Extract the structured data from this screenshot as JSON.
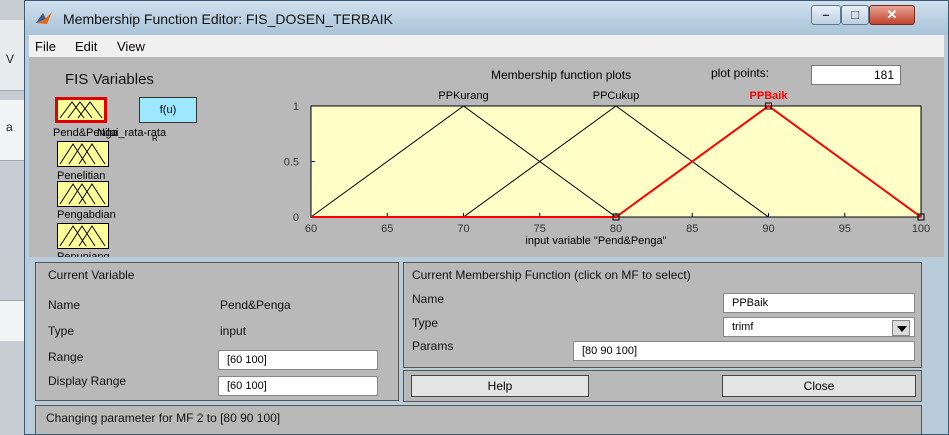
{
  "window": {
    "title": "Membership Function Editor: FIS_DOSEN_TERBAIK"
  },
  "menu": [
    "File",
    "Edit",
    "View"
  ],
  "background_letters": [
    "V",
    "a"
  ],
  "fis_variables": {
    "heading": "FIS Variables",
    "inputs": [
      {
        "label": "Pend&Penga",
        "selected": true
      },
      {
        "label": "Penelitian",
        "selected": false
      },
      {
        "label": "Pengabdian",
        "selected": false
      },
      {
        "label": "Penunjang",
        "selected": false
      }
    ],
    "output_label": "f(u)",
    "output_name": "Nilai_rata-rata",
    "output_glyph": "R"
  },
  "plot": {
    "title": "Membership function plots",
    "plot_points_label": "plot points:",
    "plot_points_value": "181"
  },
  "chart_data": {
    "type": "line",
    "xlabel": "input variable \"Pend&Penga\"",
    "xlim": [
      60,
      100
    ],
    "ylim": [
      0,
      1
    ],
    "xticks": [
      60,
      65,
      70,
      75,
      80,
      85,
      90,
      95,
      100
    ],
    "yticks": [
      0,
      0.5,
      1
    ],
    "series": [
      {
        "name": "PPKurang",
        "params": [
          60,
          70,
          80
        ],
        "color": "#000000",
        "selected": false
      },
      {
        "name": "PPCukup",
        "params": [
          70,
          80,
          90
        ],
        "color": "#000000",
        "selected": false
      },
      {
        "name": "PPBaik",
        "params": [
          80,
          90,
          100
        ],
        "color": "#ff0000",
        "selected": true
      }
    ]
  },
  "current_variable": {
    "heading": "Current Variable",
    "name_label": "Name",
    "name_value": "Pend&Penga",
    "type_label": "Type",
    "type_value": "input",
    "range_label": "Range",
    "range_value": "[60 100]",
    "display_range_label": "Display Range",
    "display_range_value": "[60 100]"
  },
  "current_mf": {
    "heading": "Current Membership Function (click on MF to select)",
    "name_label": "Name",
    "name_value": "PPBaik",
    "type_label": "Type",
    "type_value": "trimf",
    "params_label": "Params",
    "params_value": "[80 90 100]"
  },
  "buttons": {
    "help": "Help",
    "close": "Close"
  },
  "status": "Changing parameter for MF 2 to  [80 90 100]",
  "colors": {
    "mf_bg": "#ffff9a",
    "output_box": "#9ee8ff",
    "selected": "#ff0000",
    "panel": "#b9b9b9"
  }
}
